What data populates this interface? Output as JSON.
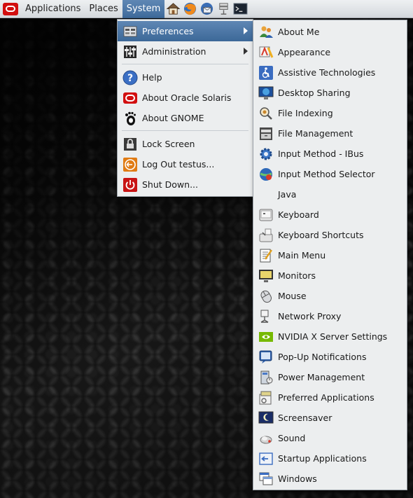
{
  "panel": {
    "logo_icon": "oracle-logo-icon",
    "menus": [
      "Applications",
      "Places",
      "System"
    ],
    "launchers": [
      "home-folder-icon",
      "firefox-icon",
      "thunderbird-icon",
      "network-monitor-icon",
      "terminal-icon"
    ]
  },
  "system_menu": {
    "items": [
      {
        "label": "Preferences",
        "icon": "preferences-icon",
        "submenu": true
      },
      {
        "label": "Administration",
        "icon": "administration-icon",
        "submenu": true
      },
      {
        "label": "Help",
        "icon": "help-icon"
      },
      {
        "label": "About Oracle Solaris",
        "icon": "oracle-solaris-icon"
      },
      {
        "label": "About GNOME",
        "icon": "gnome-foot-icon"
      },
      {
        "label": "Lock Screen",
        "icon": "lock-icon"
      },
      {
        "label": "Log Out testus...",
        "icon": "logout-icon"
      },
      {
        "label": "Shut Down...",
        "icon": "power-icon"
      }
    ]
  },
  "preferences_menu": {
    "items": [
      {
        "label": "About Me",
        "icon": "about-me-icon"
      },
      {
        "label": "Appearance",
        "icon": "appearance-icon"
      },
      {
        "label": "Assistive Technologies",
        "icon": "accessibility-icon"
      },
      {
        "label": "Desktop Sharing",
        "icon": "desktop-sharing-icon"
      },
      {
        "label": "File Indexing",
        "icon": "file-indexing-icon"
      },
      {
        "label": "File Management",
        "icon": "file-management-icon"
      },
      {
        "label": "Input Method - IBus",
        "icon": "ibus-gear-icon"
      },
      {
        "label": "Input Method Selector",
        "icon": "input-method-selector-icon"
      },
      {
        "label": "Java",
        "icon": ""
      },
      {
        "label": "Keyboard",
        "icon": "keyboard-icon"
      },
      {
        "label": "Keyboard Shortcuts",
        "icon": "keyboard-shortcuts-icon"
      },
      {
        "label": "Main Menu",
        "icon": "main-menu-icon"
      },
      {
        "label": "Monitors",
        "icon": "monitor-icon"
      },
      {
        "label": "Mouse",
        "icon": "mouse-icon"
      },
      {
        "label": "Network Proxy",
        "icon": "network-proxy-icon"
      },
      {
        "label": "NVIDIA X Server Settings",
        "icon": "nvidia-icon"
      },
      {
        "label": "Pop-Up Notifications",
        "icon": "notifications-icon"
      },
      {
        "label": "Power Management",
        "icon": "power-management-icon"
      },
      {
        "label": "Preferred Applications",
        "icon": "preferred-applications-icon"
      },
      {
        "label": "Screensaver",
        "icon": "screensaver-icon"
      },
      {
        "label": "Sound",
        "icon": "sound-icon"
      },
      {
        "label": "Startup Applications",
        "icon": "startup-applications-icon"
      },
      {
        "label": "Windows",
        "icon": "windows-icon"
      }
    ]
  },
  "colors": {
    "highlight": "#4a76a8",
    "menu_bg": "#eceeef",
    "panel_bg": "#e2e5e8",
    "oracle_red": "#d20f0f"
  }
}
